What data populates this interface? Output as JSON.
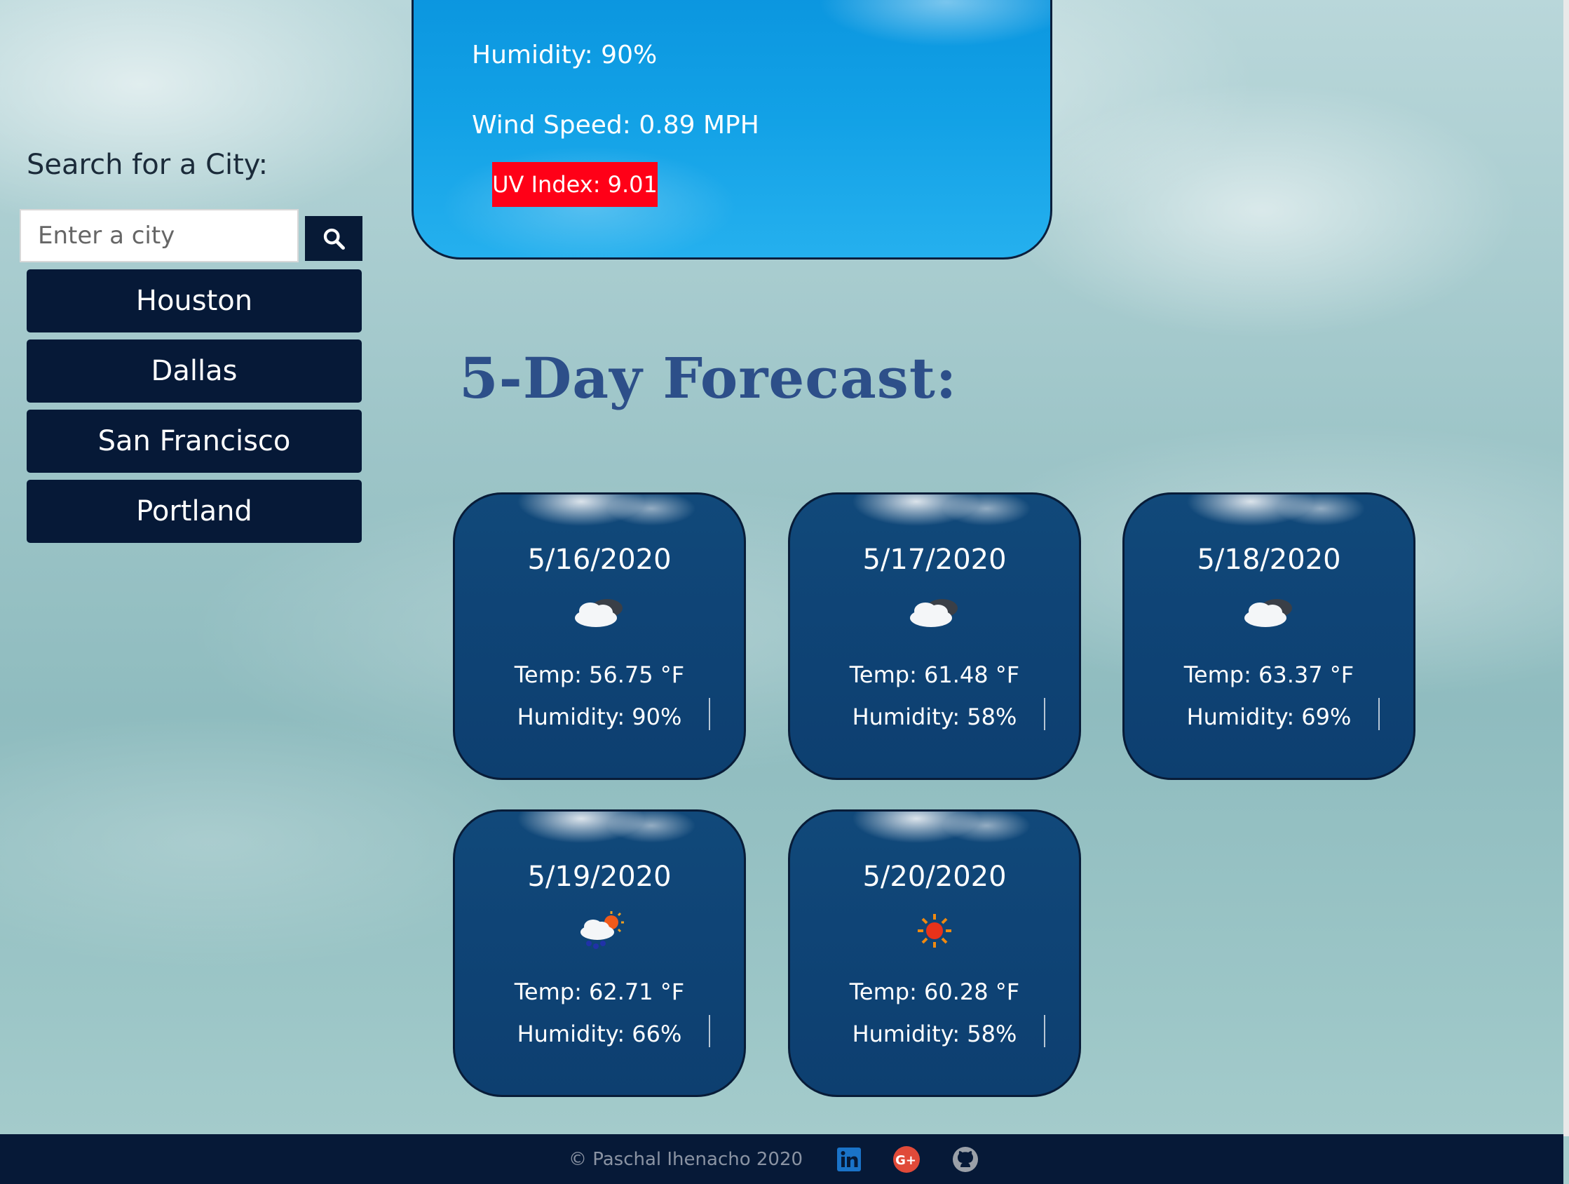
{
  "current": {
    "humidity": "Humidity: 90%",
    "wind_speed": "Wind Speed: 0.89 MPH",
    "uv_index": "UV Index: 9.01",
    "uv_color": "#ff0017"
  },
  "sidebar": {
    "search_label": "Search for a City:",
    "search_placeholder": "Enter a city",
    "search_icon": "search-icon",
    "cities": [
      {
        "label": "Houston"
      },
      {
        "label": "Dallas"
      },
      {
        "label": "San Francisco"
      },
      {
        "label": "Portland"
      }
    ]
  },
  "forecast": {
    "title": "5-Day Forecast:",
    "days": [
      {
        "date": "5/16/2020",
        "icon": "cloudy-icon",
        "temp": "Temp: 56.75 °F",
        "humidity": "Humidity: 90%"
      },
      {
        "date": "5/17/2020",
        "icon": "cloudy-icon",
        "temp": "Temp: 61.48 °F",
        "humidity": "Humidity: 58%"
      },
      {
        "date": "5/18/2020",
        "icon": "cloudy-icon",
        "temp": "Temp: 63.37 °F",
        "humidity": "Humidity: 69%"
      },
      {
        "date": "5/19/2020",
        "icon": "rain-sun-icon",
        "temp": "Temp: 62.71 °F",
        "humidity": "Humidity: 66%"
      },
      {
        "date": "5/20/2020",
        "icon": "sun-icon",
        "temp": "Temp: 60.28 °F",
        "humidity": "Humidity: 58%"
      }
    ]
  },
  "footer": {
    "copyright": "© Paschal Ihenacho 2020",
    "icons": [
      "linkedin-icon",
      "google-plus-icon",
      "github-icon"
    ]
  },
  "colors": {
    "navy": "#061937",
    "heading": "#2d4f89",
    "card": "#0f4476"
  }
}
